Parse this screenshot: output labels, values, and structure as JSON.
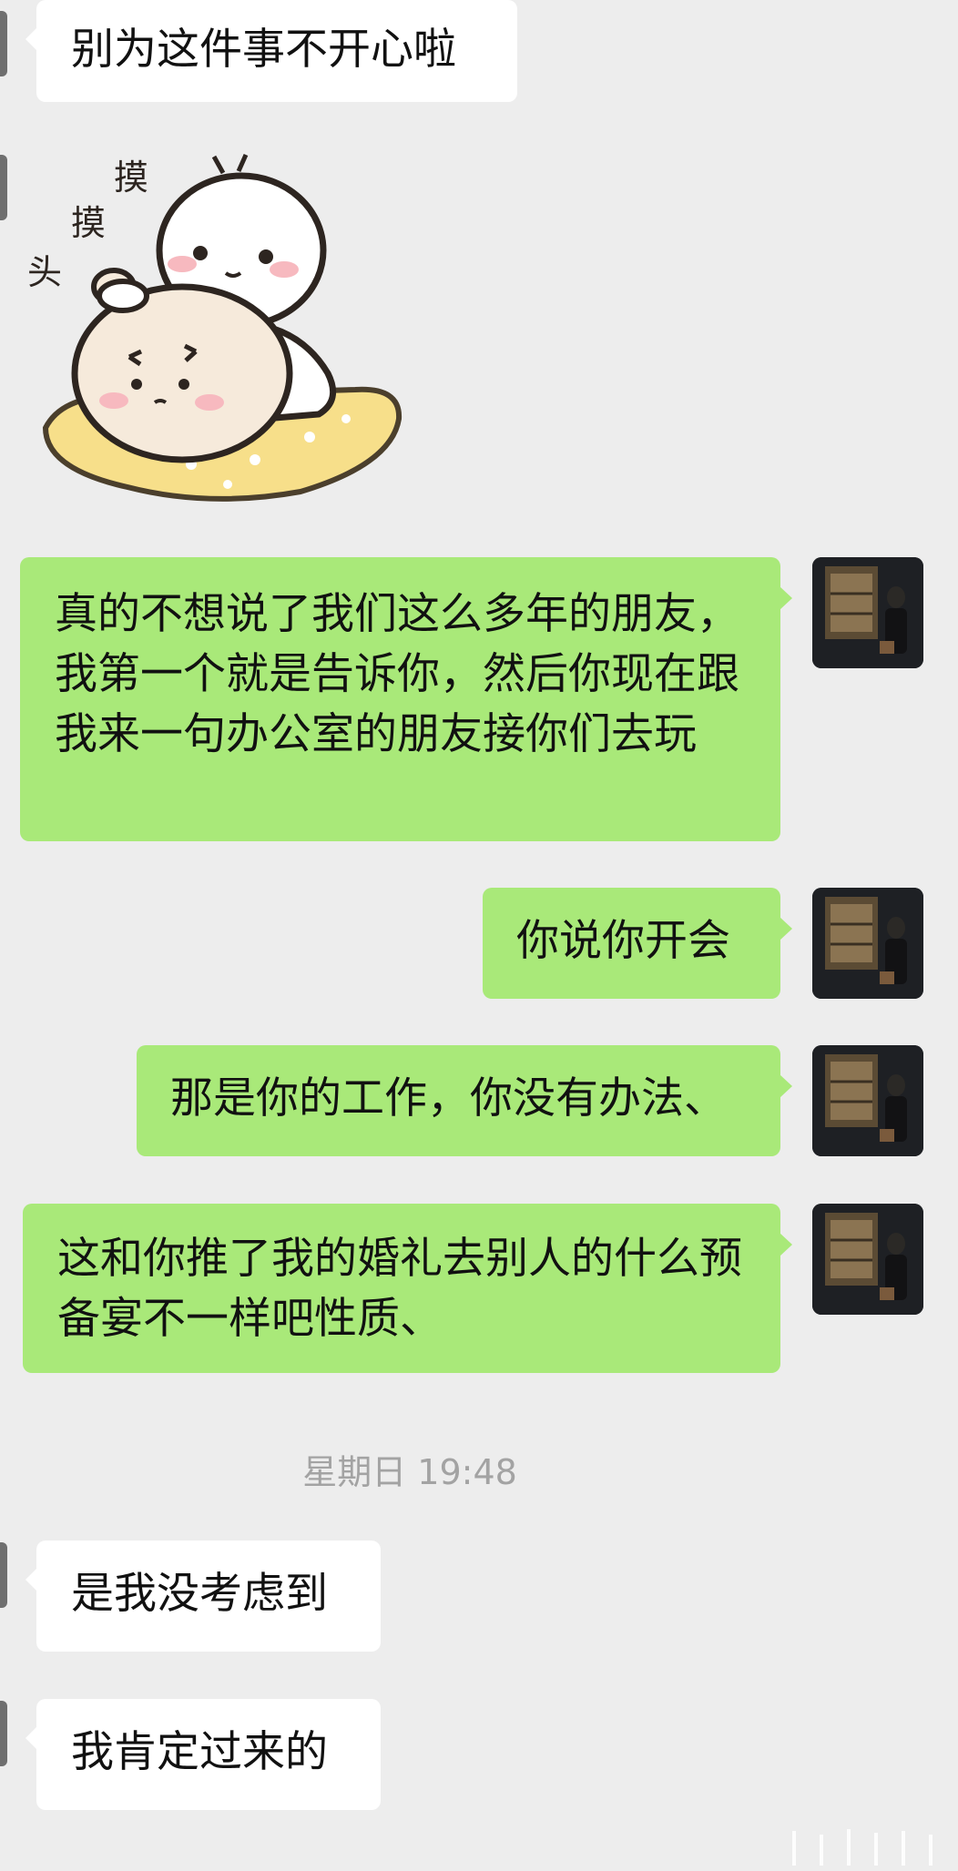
{
  "messages": [
    {
      "side": "left",
      "text": "别为这件事不开心啦"
    },
    {
      "side": "left",
      "sticker": true
    },
    {
      "side": "right",
      "text": "真的不想说了我们这么多年的朋友，我第一个就是告诉你，然后你现在跟我来一句办公室的朋友接你们去玩"
    },
    {
      "side": "right",
      "text": "你说你开会"
    },
    {
      "side": "right",
      "text": "那是你的工作，你没有办法、"
    },
    {
      "side": "right",
      "text": "这和你推了我的婚礼去别人的什么预备宴不一样吧性质、"
    },
    {
      "side": "left",
      "text": "是我没考虑到"
    },
    {
      "side": "left",
      "text": "我肯定过来的"
    }
  ],
  "sticker": {
    "chars": [
      "摸",
      "摸",
      "头"
    ]
  },
  "timestamp": "星期日 19:48",
  "colors": {
    "background": "#ededed",
    "self_bubble": "#a9e979",
    "other_bubble": "#ffffff"
  }
}
